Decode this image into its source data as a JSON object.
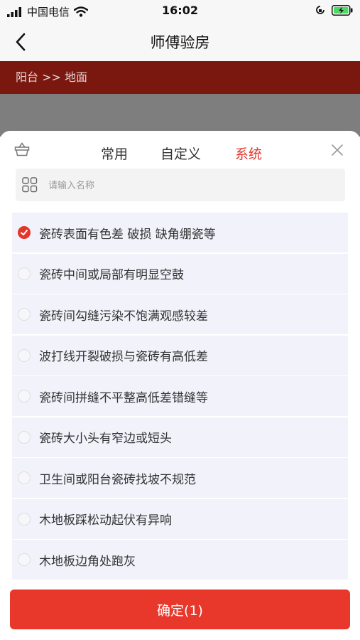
{
  "status_bar": {
    "carrier": "中国电信",
    "time": "16:02"
  },
  "nav": {
    "title": "师傅验房"
  },
  "breadcrumb": {
    "text": "阳台 >> 地面"
  },
  "tabs": [
    {
      "label": "常用",
      "active": false
    },
    {
      "label": "自定义",
      "active": false
    },
    {
      "label": "系统",
      "active": true
    }
  ],
  "search": {
    "placeholder": "请输入名称",
    "value": ""
  },
  "items": [
    {
      "label": "瓷砖表面有色差 破损 缺角绷瓷等",
      "checked": true
    },
    {
      "label": "瓷砖中间或局部有明显空鼓",
      "checked": false
    },
    {
      "label": "瓷砖间勾缝污染不饱满观感较差",
      "checked": false
    },
    {
      "label": "波打线开裂破损与瓷砖有高低差",
      "checked": false
    },
    {
      "label": "瓷砖间拼缝不平整高低差错缝等",
      "checked": false
    },
    {
      "label": "瓷砖大小头有窄边或短头",
      "checked": false
    },
    {
      "label": "卫生间或阳台瓷砖找坡不规范",
      "checked": false
    },
    {
      "label": "木地板踩松动起伏有异响",
      "checked": false
    },
    {
      "label": "木地板边角处跑灰",
      "checked": false
    }
  ],
  "confirm": {
    "label": "确定(1)"
  },
  "colors": {
    "accent": "#e3362b",
    "breadcrumb_bg": "#7a1810",
    "item_bg": "#f2f2fb"
  }
}
